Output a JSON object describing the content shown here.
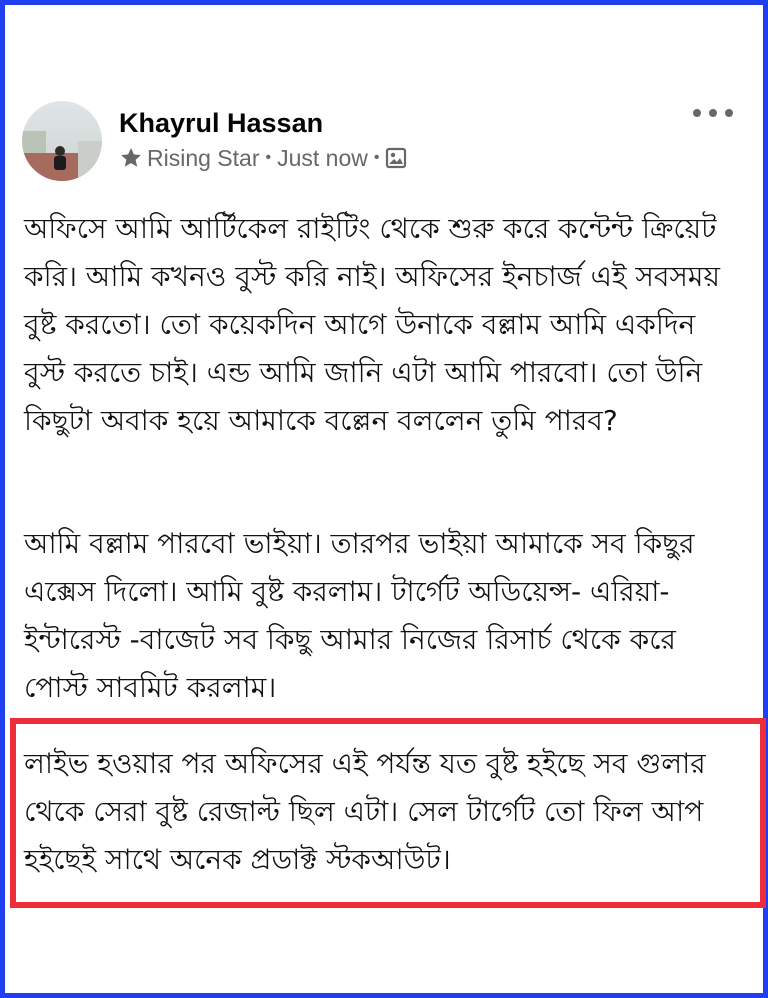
{
  "post": {
    "author": "Khayrul Hassan",
    "badge": "Rising Star",
    "time": "Just now",
    "separator": "•",
    "paragraphs": [
      "অফিসে আমি আর্টিকেল রাইটিং থেকে শুরু করে কন্টেন্ট ক্রিয়েট করি। আমি কখনও বুস্ট করি নাই। অফিসের ইনচার্জ এই সবসময় বুষ্ট করতো। তো কয়েকদিন আগে উনাকে বল্লাম আমি একদিন বুস্ট করতে চাই। এন্ড আমি জানি এটা আমি পারবো। তো উনি কিছুটা অবাক হয়ে আমাকে বল্লেন বললেন তুমি পারব?",
      "আমি বল্লাম পারবো ভাইয়া। তারপর ভাইয়া আমাকে সব কিছুর এক্সেস দিলো। আমি বুষ্ট করলাম। টার্গেট অডিয়েন্স- এরিয়া- ইন্টারেস্ট -বাজেট সব কিছু আমার নিজের রিসার্চ থেকে করে পোস্ট সাবমিট করলাম।",
      "লাইভ হওয়ার পর অফিসের এই পর্যন্ত যত বুষ্ট হইছে সব গুলার থেকে সেরা বুষ্ট রেজাল্ট ছিল এটা। সেল টার্গেট তো ফিল আপ হইছেই সাথে অনেক প্রডাক্ট স্টকআউট।"
    ]
  },
  "icons": {
    "badge": "star-icon",
    "audience": "photo-audience-icon",
    "more": "more-options-icon",
    "avatar": "profile-photo"
  },
  "colors": {
    "frame_border": "#1f3ff0",
    "highlight_border": "#ee2d3a",
    "secondary_text": "#65676b"
  }
}
